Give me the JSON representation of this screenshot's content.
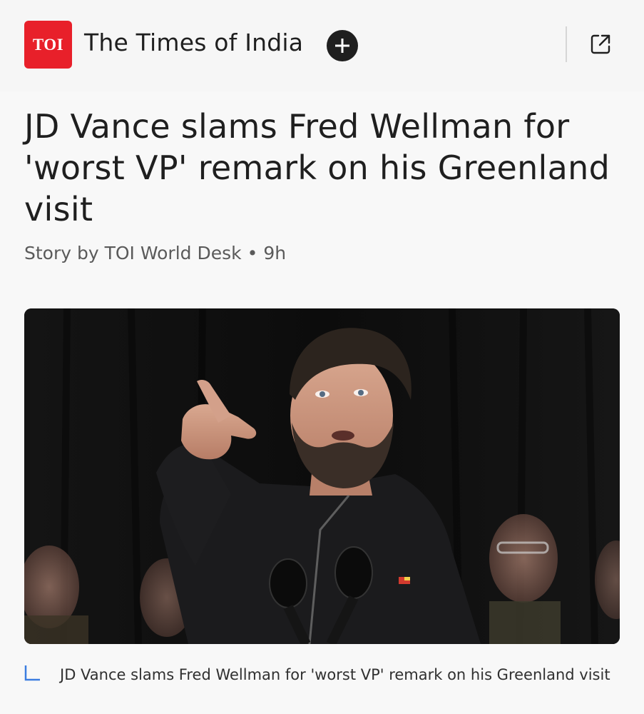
{
  "header": {
    "logo_text": "TOI",
    "publisher": "The Times of India",
    "follow_icon": "plus-icon",
    "share_icon": "external-link-icon"
  },
  "article": {
    "headline": "JD Vance slams Fred Wellman for 'worst VP' remark on his Greenland visit",
    "byline": "Story by TOI World Desk",
    "age": "9h",
    "image": {
      "subject": "man in dark jacket pointing at a microphone podium, people in background"
    },
    "caption": "JD Vance slams Fred Wellman for 'worst VP' remark on his Greenland visit"
  },
  "colors": {
    "brand": "#e8202a",
    "caption_icon": "#3b7de0"
  }
}
